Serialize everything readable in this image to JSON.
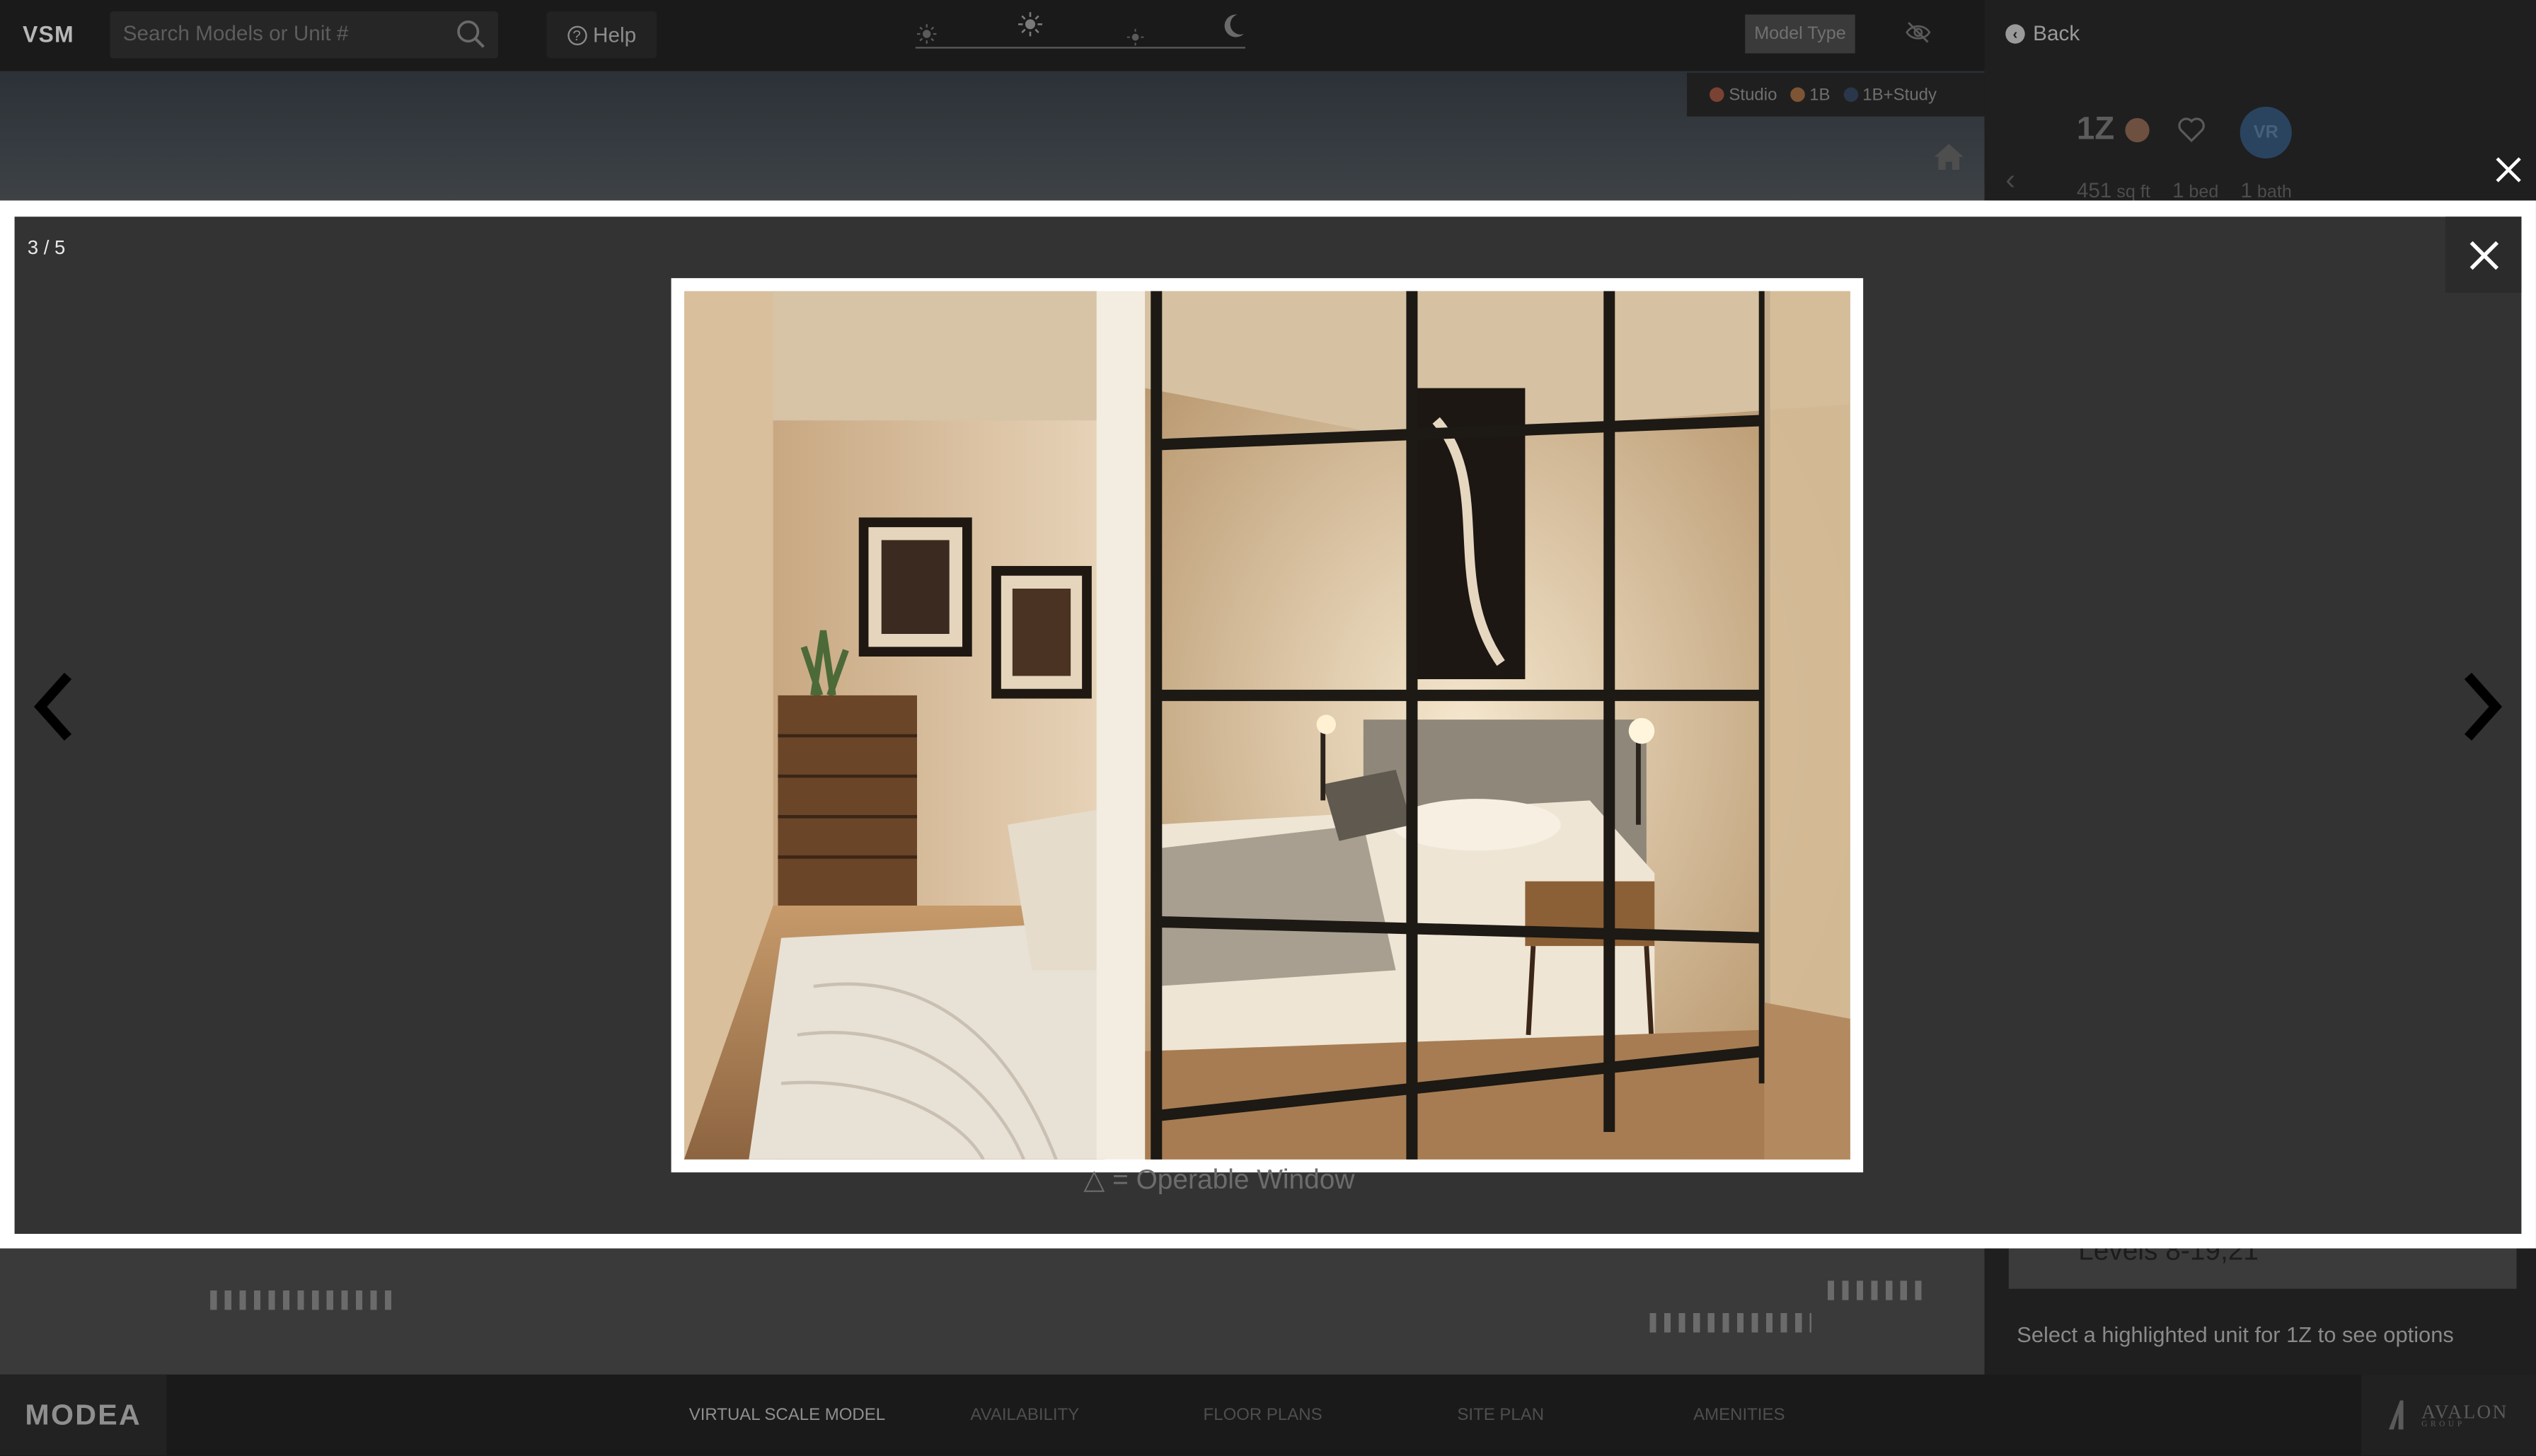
{
  "topbar": {
    "logo": "VSM",
    "search_placeholder": "Search Models or Unit #",
    "help_label": "Help",
    "model_type_label": "Model Type"
  },
  "legend": {
    "items": [
      {
        "label": "Studio",
        "color": "#8a4a3a"
      },
      {
        "label": "1B",
        "color": "#8a5e3a"
      },
      {
        "label": "1B+Study",
        "color": "#2e3b52"
      }
    ]
  },
  "panel": {
    "back_label": "Back",
    "unit_name": "1Z",
    "vr_label": "VR",
    "sqft": "451",
    "sqft_unit": "sq ft",
    "beds": "1",
    "beds_unit": "bed",
    "baths": "1",
    "baths_unit": "bath",
    "levels_text": "Levels 8-19,21",
    "select_hint": "Select a highlighted unit for 1Z to see options"
  },
  "lightbox": {
    "counter": "3 / 5",
    "underlying_label": "△ = Operable Window"
  },
  "footer": {
    "brand": "MODEA",
    "nav": [
      {
        "label": "VIRTUAL SCALE MODEL",
        "active": true
      },
      {
        "label": "AVAILABILITY",
        "active": false
      },
      {
        "label": "FLOOR PLANS",
        "active": false
      },
      {
        "label": "SITE PLAN",
        "active": false
      },
      {
        "label": "AMENITIES",
        "active": false
      }
    ],
    "partner_name": "AVALON",
    "partner_sub": "GROUP"
  }
}
